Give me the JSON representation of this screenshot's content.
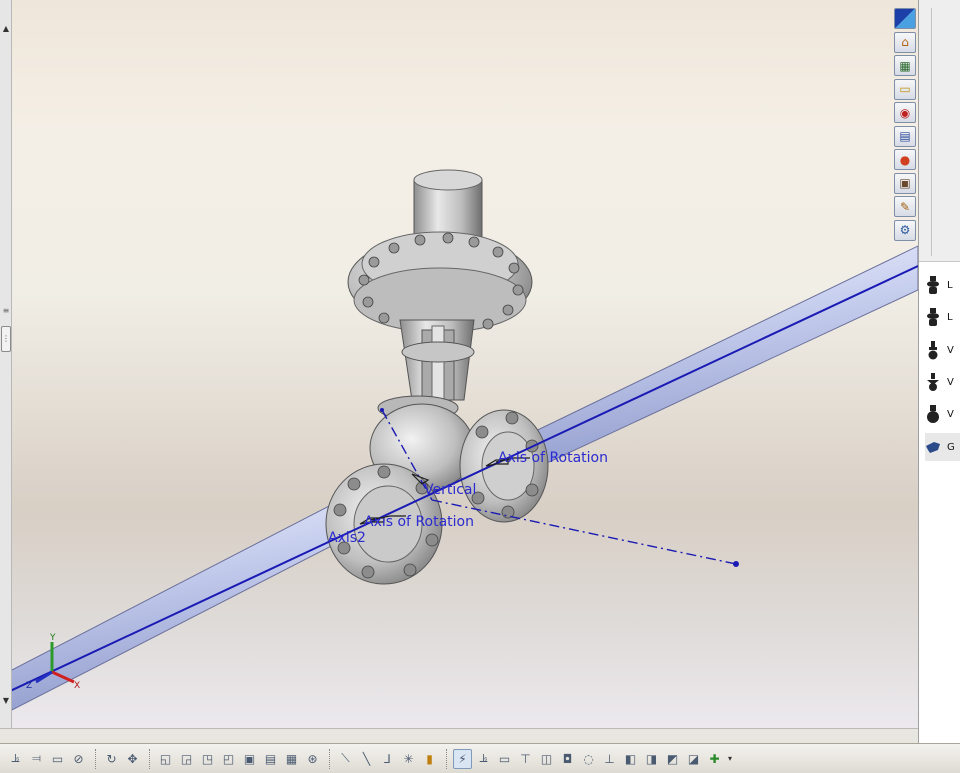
{
  "viewport": {
    "annotations": {
      "axis_of_rotation_1": "Axis of Rotation",
      "vertical": "Vertical",
      "axis_of_rotation_2": "Axis of Rotation",
      "axis2": "Axis2"
    },
    "triad": {
      "x": "X",
      "y": "Y",
      "z": "Z"
    }
  },
  "task_pane": {
    "buttons": [
      {
        "name": "solidworks-resources-icon",
        "glyph": "◪"
      },
      {
        "name": "home-icon",
        "glyph": "⌂"
      },
      {
        "name": "design-library-icon",
        "glyph": "▦"
      },
      {
        "name": "file-explorer-icon",
        "glyph": "▭"
      },
      {
        "name": "search-icon",
        "glyph": "◉"
      },
      {
        "name": "view-palette-icon",
        "glyph": "▤"
      },
      {
        "name": "appearances-icon",
        "glyph": "●"
      },
      {
        "name": "custom-properties-icon",
        "glyph": "▣"
      },
      {
        "name": "forum-icon",
        "glyph": "✎"
      },
      {
        "name": "toolbox-icon",
        "glyph": "⚙"
      }
    ]
  },
  "library": {
    "items": [
      {
        "label": "L",
        "icon": "valve-icon"
      },
      {
        "label": "L",
        "icon": "valve-icon"
      },
      {
        "label": "V",
        "icon": "valve-icon"
      },
      {
        "label": "V",
        "icon": "valve-icon"
      },
      {
        "label": "V",
        "icon": "valve-icon"
      },
      {
        "label": "G",
        "icon": "pipe-fitting-icon"
      }
    ]
  },
  "toolbar": {
    "groups": [
      [
        "align-icon",
        "align-distribute-icon",
        "view-icon",
        "hide-icon"
      ],
      [
        "rotate-icon",
        "pan-icon"
      ],
      [
        "sketch-icon",
        "smart-dimension-icon",
        "sketch-text-icon",
        "relations-icon",
        "repair-icon",
        "quick-snaps-icon",
        "rapid-sketch-icon",
        "instant-3d-icon"
      ],
      [
        "line-icon",
        "centerline-icon",
        "trim-icon",
        "point-icon",
        "construction-icon"
      ],
      [
        "routing-icon",
        "route-tools-icon",
        "edit-route-icon",
        "flange-icon",
        "fitting-icon",
        "elbow-icon",
        "coupling-icon",
        "pipe-icon",
        "spool-icon",
        "component-icon",
        "drawing-icon",
        "library-icon",
        "add-point-icon"
      ]
    ],
    "active_button": "routing-icon"
  },
  "colors": {
    "pipe": "#c9d2f0",
    "axis_line": "#1a1ab4",
    "valve": "#c8c8c8",
    "annotation_text": "#2a2ad0"
  }
}
